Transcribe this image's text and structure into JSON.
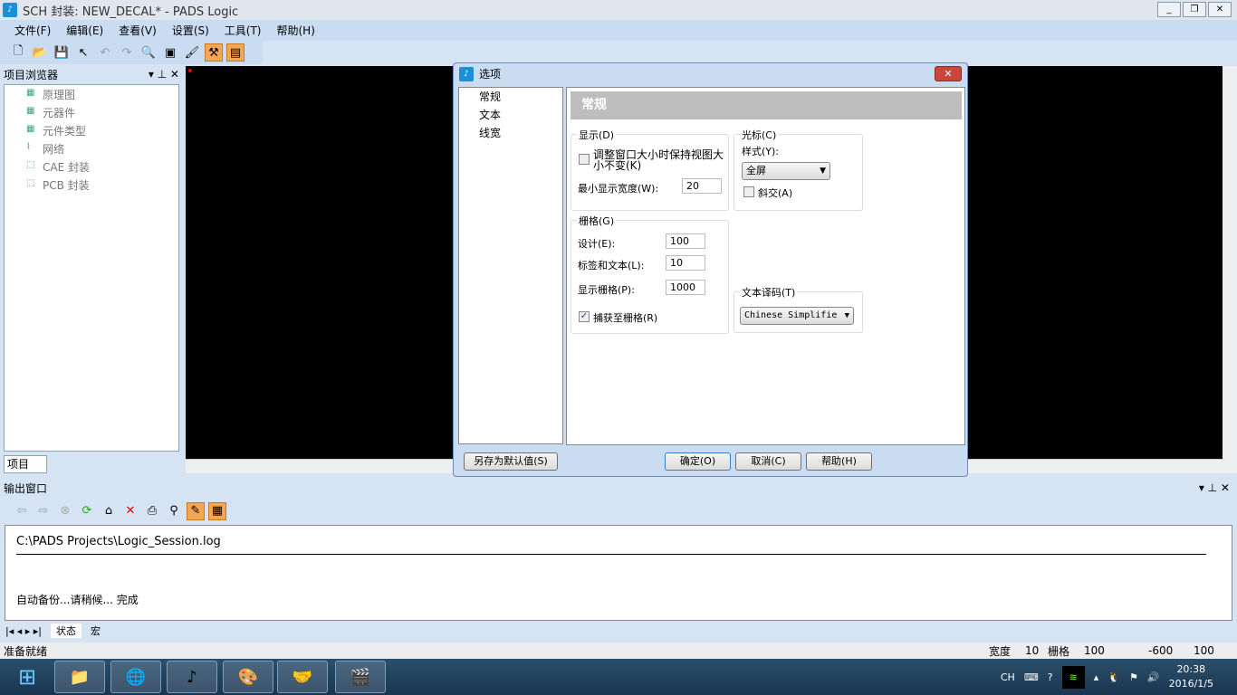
{
  "window": {
    "title": "SCH 封装: NEW_DECAL* - PADS Logic",
    "min": "_",
    "max": "❐",
    "close": "✕"
  },
  "menu": [
    "文件(F)",
    "编辑(E)",
    "查看(V)",
    "设置(S)",
    "工具(T)",
    "帮助(H)"
  ],
  "toolbar_icons": [
    "new-icon",
    "open-icon",
    "save-icon",
    "select-icon",
    "undo-icon",
    "redo-icon",
    "zoom-icon",
    "properties-icon",
    "paint-icon",
    "hammer-icon",
    "window-icon"
  ],
  "project_browser": {
    "title": "项目浏览器",
    "tab": "项目",
    "items": [
      "原理图",
      "元器件",
      "元件类型",
      "网络",
      "CAE 封装",
      "PCB 封装"
    ]
  },
  "dialog": {
    "title": "选项",
    "close": "✕",
    "categories": [
      "常规",
      "文本",
      "线宽"
    ],
    "section": "常规",
    "display": {
      "label": "显示(D)",
      "keep_view": "调整窗口大小时保持视图大小不变(K)",
      "keep_view_checked": false,
      "min_width_label": "最小显示宽度(W):",
      "min_width": "20"
    },
    "cursor": {
      "label": "光标(C)",
      "style_label": "样式(Y):",
      "style": "全屏",
      "diagonal": "斜交(A)",
      "diagonal_checked": false
    },
    "grid": {
      "label": "栅格(G)",
      "design_label": "设计(E):",
      "design": "100",
      "label_text_label": "标签和文本(L):",
      "label_text": "10",
      "display_label": "显示栅格(P):",
      "display": "1000",
      "snap": "捕获至栅格(R)",
      "snap_checked": true
    },
    "encoding": {
      "label": "文本译码(T)",
      "value": "Chinese Simplifie"
    },
    "buttons": {
      "save_default": "另存为默认值(S)",
      "ok": "确定(O)",
      "cancel": "取消(C)",
      "help": "帮助(H)"
    }
  },
  "output": {
    "title": "输出窗口",
    "lines": [
      "C:\\PADS Projects\\Logic_Session.log",
      "自动备份...请稍候... 完成"
    ],
    "tabs": [
      "状态",
      "宏"
    ]
  },
  "status": {
    "text": "准备就绪",
    "width_label": "宽度",
    "width": "10",
    "grid_label": "栅格",
    "grid": "100",
    "x": "-600",
    "y": "100"
  },
  "taskbar": {
    "lang": "CH",
    "time": "20:38",
    "date": "2016/1/5"
  }
}
